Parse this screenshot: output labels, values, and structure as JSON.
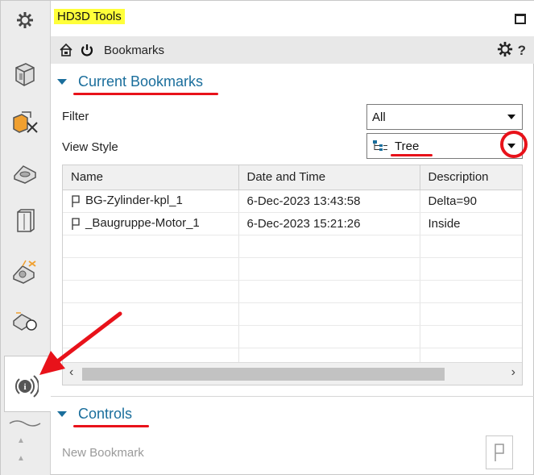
{
  "window": {
    "title": "HD3D Tools"
  },
  "toolbar": {
    "label": "Bookmarks"
  },
  "sections": {
    "current": {
      "title": "Current Bookmarks"
    },
    "controls": {
      "title": "Controls"
    }
  },
  "filter": {
    "label": "Filter",
    "value": "All"
  },
  "view_style": {
    "label": "View Style",
    "value": "Tree"
  },
  "table": {
    "columns": [
      "Name",
      "Date and Time",
      "Description"
    ],
    "rows": [
      {
        "name": "BG-Zylinder-kpl_1",
        "date": "6-Dec-2023 13:43:58",
        "description": "Delta=90"
      },
      {
        "name": "_Baugruppe-Motor_1",
        "date": "6-Dec-2023 15:21:26",
        "description": "Inside"
      }
    ]
  },
  "controls": {
    "new_bookmark_label": "New Bookmark"
  },
  "colors": {
    "accent": "#1a6e9c",
    "annotation": "#e8121a",
    "title_highlight": "#ffff3a"
  }
}
